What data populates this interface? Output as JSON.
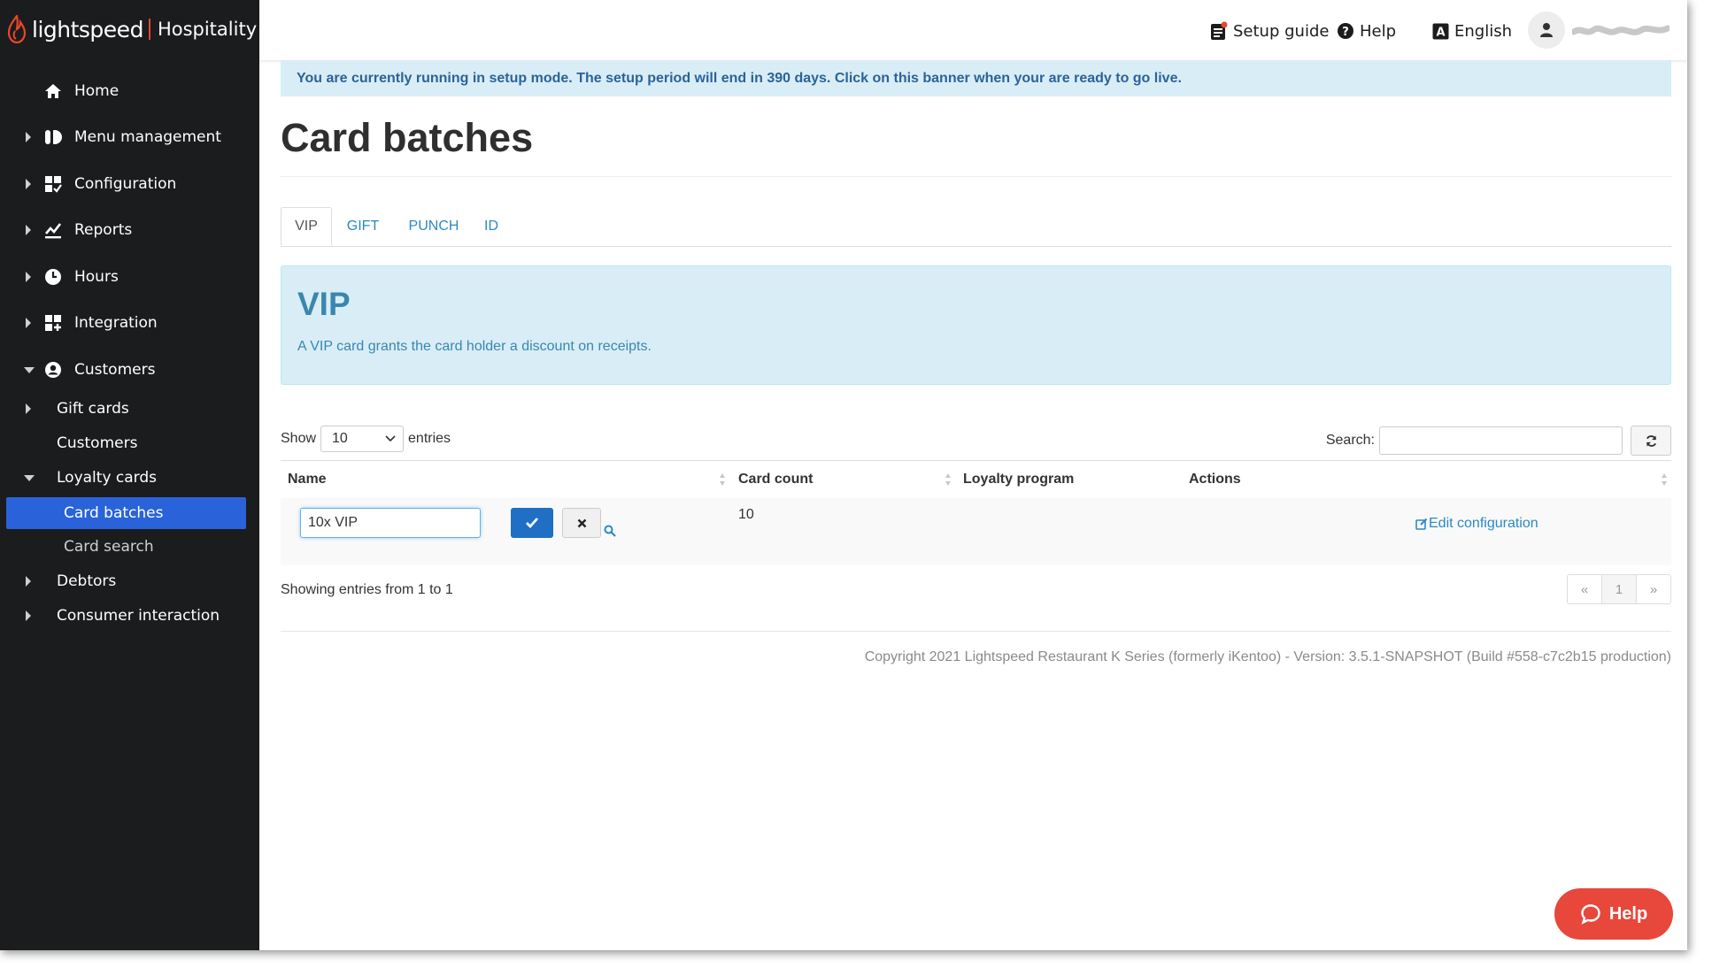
{
  "brand": {
    "name": "lightspeed",
    "product": "Hospitality",
    "accent": "#e8472b"
  },
  "topbar": {
    "setup_guide": "Setup guide",
    "help": "Help",
    "language": "English"
  },
  "sidebar": {
    "items": [
      {
        "label": "Home",
        "icon": "home-icon"
      },
      {
        "label": "Menu management",
        "icon": "menu-management-icon"
      },
      {
        "label": "Configuration",
        "icon": "configuration-icon"
      },
      {
        "label": "Reports",
        "icon": "reports-icon"
      },
      {
        "label": "Hours",
        "icon": "clock-icon"
      },
      {
        "label": "Integration",
        "icon": "integration-icon"
      },
      {
        "label": "Customers",
        "icon": "customers-icon"
      }
    ],
    "customers_sub": {
      "gift_cards": "Gift cards",
      "customers": "Customers",
      "loyalty_cards": "Loyalty cards",
      "card_batches": "Card batches",
      "card_search": "Card search",
      "debtors": "Debtors",
      "consumer_interaction": "Consumer interaction"
    },
    "active_color": "#2a63d9"
  },
  "banner": "You are currently running in setup mode. The setup period will end in 390 days. Click on this banner when your are ready to go live.",
  "page_title": "Card batches",
  "tabs": [
    "VIP",
    "GIFT",
    "PUNCH",
    "ID"
  ],
  "info": {
    "title": "VIP",
    "description": "A VIP card grants the card holder a discount on receipts."
  },
  "table_controls": {
    "show": "Show",
    "entries_value": "10",
    "entries": "entries",
    "search_label": "Search:",
    "search_value": ""
  },
  "table": {
    "columns": [
      "Name",
      "Card count",
      "Loyalty program",
      "Actions"
    ],
    "rows": [
      {
        "name": "10x VIP",
        "card_count": "10",
        "loyalty_program": "",
        "action": "Edit configuration"
      }
    ]
  },
  "showing": "Showing entries from 1 to 1",
  "pagination": {
    "prev": "«",
    "current": "1",
    "next": "»"
  },
  "footer": "Copyright 2021 Lightspeed Restaurant K Series (formerly iKentoo) - Version: 3.5.1-SNAPSHOT (Build #558-c7c2b15 production)",
  "help_widget": "Help"
}
